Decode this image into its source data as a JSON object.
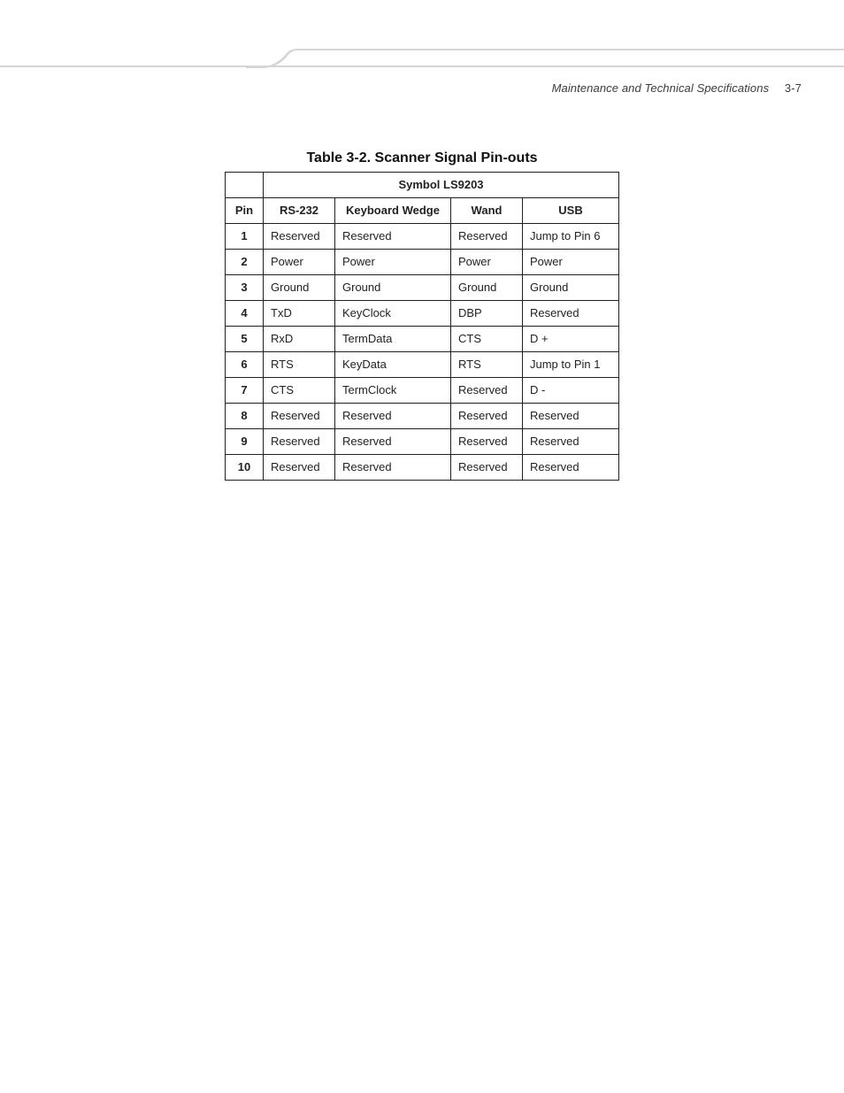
{
  "runningHead": {
    "section": "Maintenance and Technical Specifications",
    "pageNumber": "3-7"
  },
  "caption": "Table 3-2. Scanner Signal Pin-outs",
  "table": {
    "superHeader": "Symbol  LS9203",
    "columns": [
      "Pin",
      "RS-232",
      "Keyboard Wedge",
      "Wand",
      "USB"
    ],
    "rows": [
      {
        "pin": "1",
        "cells": [
          "Reserved",
          "Reserved",
          "Reserved",
          "Jump to Pin 6"
        ]
      },
      {
        "pin": "2",
        "cells": [
          "Power",
          "Power",
          "Power",
          "Power"
        ]
      },
      {
        "pin": "3",
        "cells": [
          "Ground",
          "Ground",
          "Ground",
          "Ground"
        ]
      },
      {
        "pin": "4",
        "cells": [
          "TxD",
          "KeyClock",
          "DBP",
          "Reserved"
        ]
      },
      {
        "pin": "5",
        "cells": [
          "RxD",
          "TermData",
          "CTS",
          "D +"
        ]
      },
      {
        "pin": "6",
        "cells": [
          "RTS",
          "KeyData",
          "RTS",
          "Jump to Pin 1"
        ]
      },
      {
        "pin": "7",
        "cells": [
          "CTS",
          "TermClock",
          "Reserved",
          "D -"
        ]
      },
      {
        "pin": "8",
        "cells": [
          "Reserved",
          "Reserved",
          "Reserved",
          "Reserved"
        ]
      },
      {
        "pin": "9",
        "cells": [
          "Reserved",
          "Reserved",
          "Reserved",
          "Reserved"
        ]
      },
      {
        "pin": "10",
        "cells": [
          "Reserved",
          "Reserved",
          "Reserved",
          "Reserved"
        ]
      }
    ]
  }
}
